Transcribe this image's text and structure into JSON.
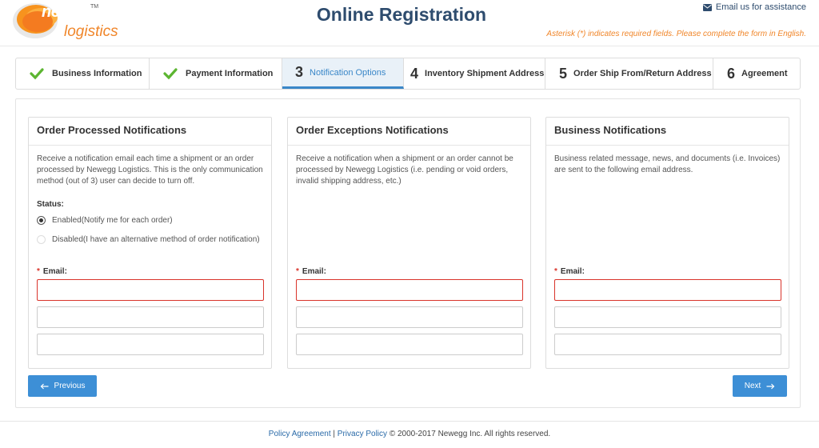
{
  "header": {
    "logo_word": "newegg",
    "logo_tm": "TM",
    "logo_sub": "logistics",
    "title": "Online Registration",
    "assist_link": "Email us for assistance",
    "required_note": "Asterisk (*) indicates required fields. Please complete the form in English."
  },
  "steps": [
    {
      "num": "",
      "label": "Business Information",
      "state": "done"
    },
    {
      "num": "",
      "label": "Payment Information",
      "state": "done"
    },
    {
      "num": "3",
      "label": "Notification Options",
      "state": "active"
    },
    {
      "num": "4",
      "label": "Inventory Shipment Address",
      "state": "todo"
    },
    {
      "num": "5",
      "label": "Order Ship From/Return Address",
      "state": "todo"
    },
    {
      "num": "6",
      "label": "Agreement",
      "state": "todo"
    }
  ],
  "cards": {
    "order_processed": {
      "title": "Order Processed Notifications",
      "desc": "Receive a notification email each time a shipment or an order processed by Newegg Logistics. This is the only communication method (out of 3) user can decide to turn off.",
      "status_label": "Status:",
      "option_enabled": "Enabled(Notify me for each order)",
      "option_disabled": "Disabled(I have an alternative method of order notification)",
      "selected": "enabled",
      "email_label": "Email:"
    },
    "order_exceptions": {
      "title": "Order Exceptions Notifications",
      "desc": "Receive a notification when a shipment or an order cannot be processed by Newegg Logistics (i.e. pending or void orders, invalid shipping address, etc.)",
      "email_label": "Email:"
    },
    "business": {
      "title": "Business Notifications",
      "desc": "Business related message, news, and documents (i.e. Invoices) are sent to the following email address.",
      "email_label": "Email:"
    }
  },
  "buttons": {
    "previous": "Previous",
    "next": "Next"
  },
  "footer": {
    "policy": "Policy Agreement",
    "sep": "|",
    "privacy": "Privacy Policy",
    "copyright": "© 2000-2017 Newegg Inc. All rights reserved."
  },
  "colors": {
    "primary": "#3d8fd6",
    "title": "#2e4c6e",
    "accent_orange": "#f0862a",
    "required_red": "#d9342b",
    "check_green": "#5cb531"
  }
}
